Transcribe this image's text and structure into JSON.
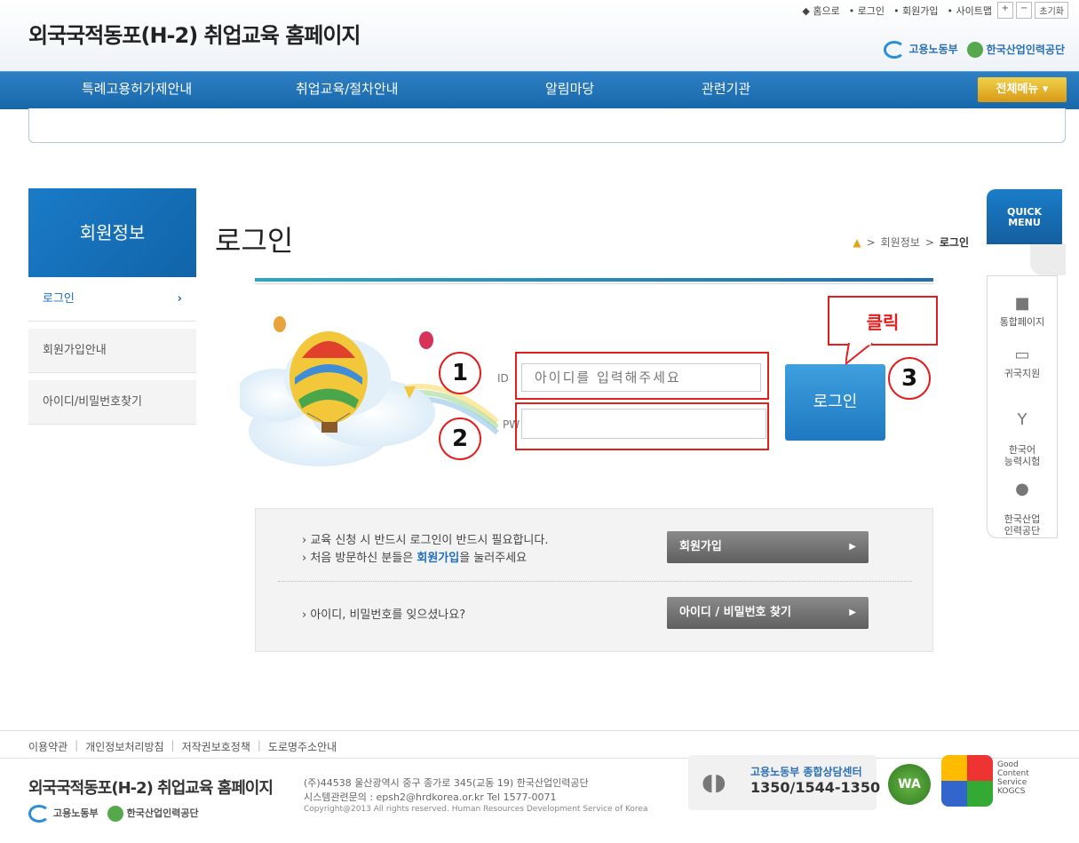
{
  "header": {
    "site_title": "외국국적동포(H-2) 취업교육 홈페이지",
    "top_links": [
      "◆ 홈으로",
      "• 로그인",
      "• 회원가입",
      "• 사이트맵"
    ],
    "font_controls": [
      "+",
      "−",
      "초기화"
    ],
    "logo_moel": "고용노동부",
    "logo_hrdk": "한국산업인력공단"
  },
  "nav": {
    "items": [
      "특례고용허가제안내",
      "취업교육/절차안내",
      "알림마당",
      "관련기관"
    ],
    "all_menu": "전체메뉴 ▾"
  },
  "sidebar": {
    "title": "회원정보",
    "items": [
      {
        "label": "로그인",
        "arrow": "›"
      },
      {
        "label": "회원가입안내"
      },
      {
        "label": "아이디/비밀번호찾기"
      }
    ]
  },
  "content": {
    "page_title": "로그인",
    "breadcrumb": [
      "회원정보",
      "로그인"
    ],
    "breadcrumb_sep": ">",
    "form": {
      "id_label": "ID",
      "id_placeholder": "아이디를 입력해주세요",
      "pw_label": "PW",
      "login_button": "로그인"
    },
    "annotations": {
      "n1": "1",
      "n2": "2",
      "n3": "3",
      "click": "클릭"
    },
    "info": {
      "line1": "› 교육 신청 시 반드시 로그인이 반드시 필요합니다.",
      "line2_pre": "› 처음 방문하신 분들은 ",
      "line2_em": "회원가입",
      "line2_post": "을 눌러주세요",
      "line3": "› 아이디, 비밀번호를 잊으셨나요?",
      "signup_button": "회원가입",
      "find_button": "아이디 / 비밀번호 찾기",
      "btn_arrow": "▶"
    }
  },
  "quick_menu": {
    "title_line1": "QUICK",
    "title_line2": "MENU",
    "items": [
      {
        "label": "통합페이지",
        "icon": "book-icon"
      },
      {
        "label": "귀국지원",
        "icon": "folder-icon"
      },
      {
        "label": "한국어\n능력시험",
        "icon": "y-icon"
      },
      {
        "label": "한국산업\n인력공단",
        "icon": "hrdk-icon"
      }
    ]
  },
  "footer": {
    "links": [
      "이용약관",
      "개인정보처리방침",
      "저작권보호정책",
      "도로명주소안내"
    ],
    "separator": "|",
    "title": "외국국적동포(H-2) 취업교육 홈페이지",
    "logo_moel": "고용노동부",
    "logo_hrdk": "한국산업인력공단",
    "address": "(주)44538 울산광역시 중구 종가로 345(교동 19) 한국산업인력공단",
    "system_contact": "시스템관련문의 : epsh2@hrdkorea.or.kr  Tel 1577-0071",
    "copyright": "Copyright@2013 All rights reserved. Human Resources Development Service of Korea",
    "callcenter_label": "고용노동부 종합상담센터",
    "callcenter_number": "1350/1544-1350",
    "wa_mark": "WA",
    "gc_text": [
      "Good",
      "Content",
      "Service",
      "KOGCS"
    ]
  }
}
